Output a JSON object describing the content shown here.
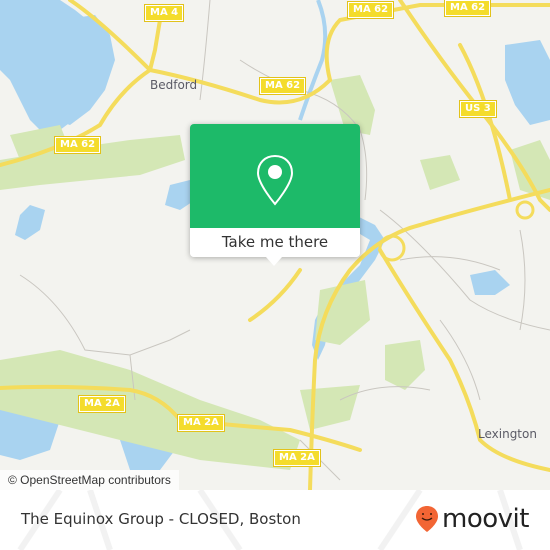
{
  "map": {
    "place_labels": [
      {
        "name": "Bedford"
      },
      {
        "name": "Lexington"
      }
    ],
    "road_shields": [
      {
        "label": "MA 4"
      },
      {
        "label": "MA 62"
      },
      {
        "label": "MA 62"
      },
      {
        "label": "MA 62"
      },
      {
        "label": "MA 62"
      },
      {
        "label": "US 3"
      },
      {
        "label": "MA 2A"
      },
      {
        "label": "MA 2A"
      },
      {
        "label": "MA 2A"
      }
    ],
    "attribution": "© OpenStreetMap contributors",
    "colors": {
      "land": "#f3f3ef",
      "water": "#a9d3f0",
      "park": "#d4e7b5",
      "highway": "#f4dc5c",
      "shield": "#f4dc2c"
    }
  },
  "popup": {
    "icon": "map-pin-icon",
    "button_label": "Take me there",
    "color": "#1dba69"
  },
  "footer": {
    "title": "The Equinox Group - CLOSED, Boston",
    "brand": "moovit",
    "brand_icon": "moovit-pin-icon",
    "brand_color": "#f26534"
  }
}
